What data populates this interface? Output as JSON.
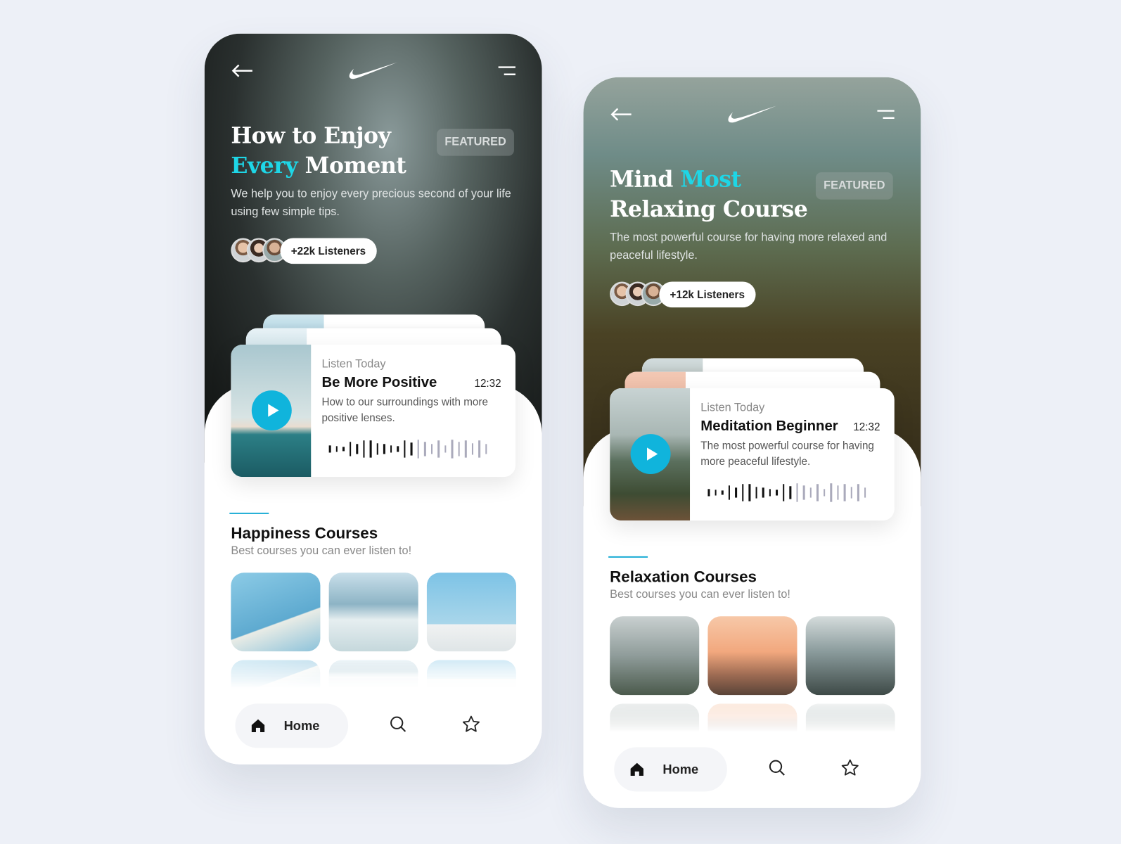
{
  "accent_color": "#1ed6e6",
  "play_color": "#10b4dc",
  "phones": [
    {
      "title_l1": "How to Enjoy",
      "title_l1_hl": "",
      "title_l2_hl": "Every",
      "title_l2": " Moment",
      "badge": "FEATURED",
      "subtitle": "We help you to enjoy every precious second of your life using few simple tips.",
      "listeners": "+22k Listeners",
      "card": {
        "label": "Listen Today",
        "title": "Be More Positive",
        "duration": "12:32",
        "description": "How to our surroundings with more positive lenses.",
        "progress": 0.54
      },
      "section_title": "Happiness Courses",
      "section_subtitle": "Best courses you can ever listen to!",
      "nav": {
        "home": "Home",
        "icons": [
          "home-icon",
          "search-icon",
          "star-icon"
        ]
      }
    },
    {
      "title_l1": "Mind ",
      "title_l1_hl": "Most",
      "title_l2_hl": "",
      "title_l2": "Relaxing Course",
      "badge": "FEATURED",
      "subtitle": "The most powerful course for having more relaxed and peaceful lifestyle.",
      "listeners": "+12k Listeners",
      "card": {
        "label": "Listen Today",
        "title": "Meditation Beginner",
        "duration": "12:32",
        "description": "The most powerful course for having more peaceful lifestyle.",
        "progress": 0.54
      },
      "section_title": "Relaxation Courses",
      "section_subtitle": "Best courses you can ever listen to!",
      "nav": {
        "home": "Home",
        "icons": [
          "home-icon",
          "search-icon",
          "star-icon"
        ]
      }
    }
  ]
}
